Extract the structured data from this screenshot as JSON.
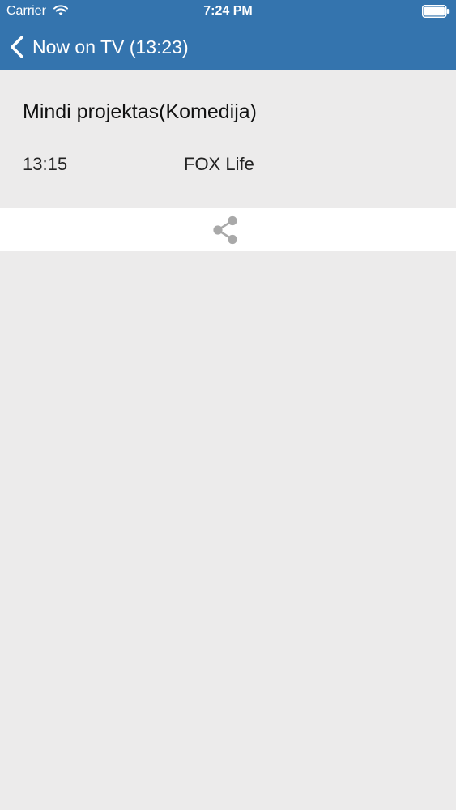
{
  "status_bar": {
    "carrier": "Carrier",
    "time": "7:24 PM"
  },
  "nav": {
    "title": "Now on TV (13:23)"
  },
  "program": {
    "title": "Mindi projektas(Komedija)",
    "time": "13:15",
    "channel": "FOX Life"
  },
  "icons": {
    "back": "chevron-left-icon",
    "share": "share-icon",
    "wifi": "wifi-icon",
    "battery": "battery-icon"
  },
  "colors": {
    "navbar": "#3474ae",
    "background": "#ecebeb",
    "share_icon": "#a9a9a9"
  }
}
